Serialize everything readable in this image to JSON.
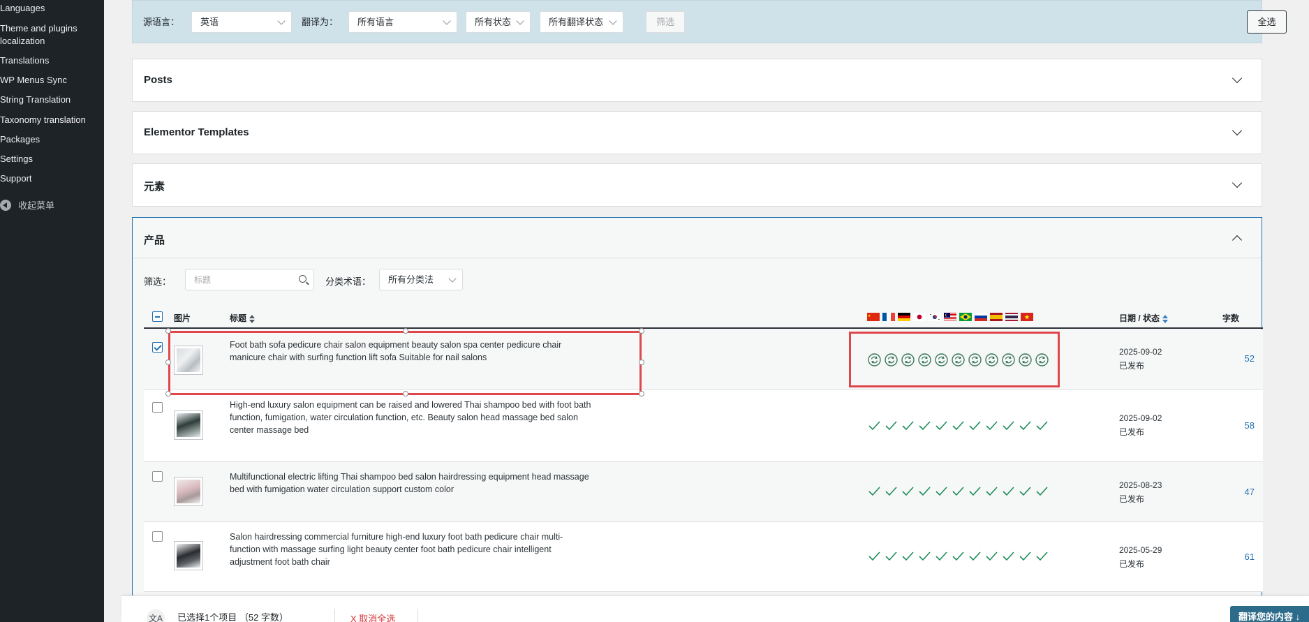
{
  "sidebar": {
    "items": [
      {
        "label": "Languages"
      },
      {
        "label": "Theme and plugins"
      },
      {
        "label": "localization"
      },
      {
        "label": "Translations"
      },
      {
        "label": "WP Menus Sync"
      },
      {
        "label": "String Translation"
      },
      {
        "label": "Taxonomy translation"
      },
      {
        "label": "Packages"
      },
      {
        "label": "Settings"
      },
      {
        "label": "Support"
      }
    ],
    "collapse_label": "收起菜单"
  },
  "filterbar": {
    "source_label": "源语言：",
    "source_value": "英语",
    "translate_label": "翻译为：",
    "translate_value": "所有语言",
    "status_value": "所有状态",
    "translation_status_value": "所有翻译状态",
    "filter_button": "筛选",
    "select_all_button": "全选"
  },
  "sections": [
    {
      "title": "Posts"
    },
    {
      "title": "Elementor Templates"
    },
    {
      "title": "元素"
    }
  ],
  "products": {
    "title": "产品",
    "filter_label": "筛选：",
    "search_placeholder": "标题",
    "taxonomy_label": "分类术语：",
    "taxonomy_value": "所有分类法",
    "columns": {
      "image": "图片",
      "title": "标题",
      "date_status": "日期 / 状态",
      "words": "字数"
    },
    "flags": [
      "cn-flag",
      "fr-flag",
      "de-flag",
      "jp-flag",
      "kr-flag",
      "my-flag",
      "br-flag",
      "ru-flag",
      "es-flag",
      "th-flag",
      "vn-flag"
    ],
    "rows": [
      {
        "checked": true,
        "thumb": "light",
        "title": "Foot bath sofa pedicure chair salon equipment beauty salon spa center pedicure chair manicure chair with surfing function lift sofa Suitable for nail salons",
        "status_icon": "needs-update-icon",
        "date": "2025-09-02",
        "status": "已发布",
        "words": "52"
      },
      {
        "checked": false,
        "thumb": "dark",
        "title": "High-end luxury salon equipment can be raised and lowered Thai shampoo bed with foot bath function, fumigation, water circulation function, etc. Beauty salon head massage bed salon center massage bed",
        "status_icon": "check-icon",
        "date": "2025-09-02",
        "status": "已发布",
        "words": "58"
      },
      {
        "checked": false,
        "thumb": "pink",
        "title": "Multifunctional electric lifting Thai shampoo bed salon hairdressing equipment head massage bed with fumigation water circulation support custom color",
        "status_icon": "check-icon",
        "date": "2025-08-23",
        "status": "已发布",
        "words": "47"
      },
      {
        "checked": false,
        "thumb": "black",
        "title": "Salon hairdressing commercial furniture high-end luxury foot bath pedicure chair multi-function with massage surfing light beauty center foot bath pedicure chair intelligent adjustment foot bath chair",
        "status_icon": "check-icon",
        "date": "2025-05-29",
        "status": "已发布",
        "words": "61"
      }
    ]
  },
  "bottombar": {
    "selected_text": "已选择1个项目 （52 字数）",
    "cancel_label": "X 取消全选",
    "translate_button": "翻译您的内容 ↓"
  },
  "colors": {
    "accent": "#2271b1",
    "highlight": "#e0474c",
    "check": "#1e8c5a",
    "sidebar": "#1d2327"
  }
}
